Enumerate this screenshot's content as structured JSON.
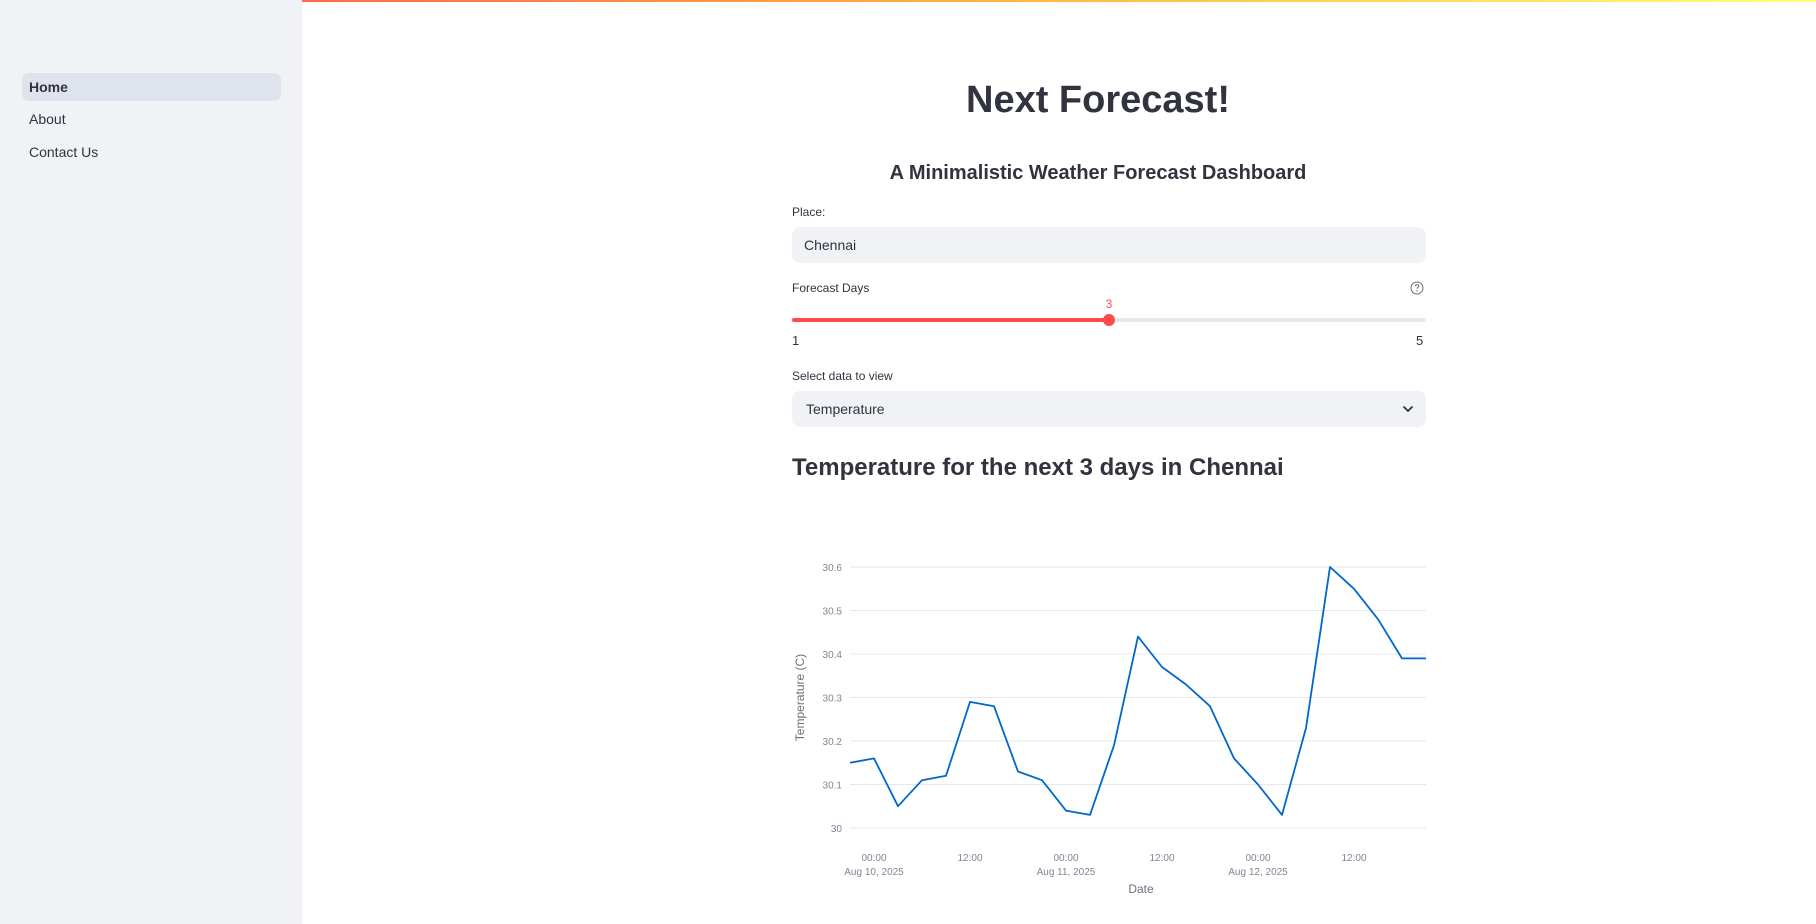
{
  "sidebar": {
    "items": [
      {
        "label": "Home",
        "active": true
      },
      {
        "label": "About",
        "active": false
      },
      {
        "label": "Contact Us",
        "active": false
      }
    ]
  },
  "main": {
    "title": "Next Forecast!",
    "subtitle": "A Minimalistic Weather Forecast Dashboard",
    "place": {
      "label": "Place:",
      "value": "Chennai",
      "placeholder": ""
    },
    "forecast_days": {
      "label": "Forecast Days",
      "min": 1,
      "max": 5,
      "value": 3,
      "min_label": "1",
      "max_label": "5",
      "value_label": "3"
    },
    "select": {
      "label": "Select data to view",
      "value": "Temperature"
    },
    "chart_heading": "Temperature for the next 3 days in Chennai"
  },
  "colors": {
    "accent": "#ff4b4b",
    "line": "#0068c9",
    "sidebar_bg": "#f0f2f6",
    "active_item_bg": "#dfe3eb",
    "text": "#31333f"
  },
  "chart_data": {
    "type": "line",
    "xlabel": "Date",
    "ylabel": "Temperature (C)",
    "ylim": [
      30,
      30.6
    ],
    "y_ticks": [
      "30",
      "30.1",
      "30.2",
      "30.3",
      "30.4",
      "30.5",
      "30.6"
    ],
    "x_ticks": [
      {
        "label": "00:00",
        "sublabel": "Aug 10, 2025"
      },
      {
        "label": "12:00",
        "sublabel": ""
      },
      {
        "label": "00:00",
        "sublabel": "Aug 11, 2025"
      },
      {
        "label": "12:00",
        "sublabel": ""
      },
      {
        "label": "00:00",
        "sublabel": "Aug 12, 2025"
      },
      {
        "label": "12:00",
        "sublabel": ""
      }
    ],
    "grid": true,
    "series": [
      {
        "x": [
          "2025-08-09 21:00",
          "2025-08-10 00:00",
          "2025-08-10 03:00",
          "2025-08-10 06:00",
          "2025-08-10 09:00",
          "2025-08-10 12:00",
          "2025-08-10 15:00",
          "2025-08-10 18:00",
          "2025-08-10 21:00",
          "2025-08-11 00:00",
          "2025-08-11 03:00",
          "2025-08-11 06:00",
          "2025-08-11 09:00",
          "2025-08-11 12:00",
          "2025-08-11 15:00",
          "2025-08-11 18:00",
          "2025-08-11 21:00",
          "2025-08-12 00:00",
          "2025-08-12 03:00",
          "2025-08-12 06:00",
          "2025-08-12 09:00",
          "2025-08-12 12:00",
          "2025-08-12 15:00",
          "2025-08-12 18:00",
          "2025-08-12 21:00"
        ],
        "values": [
          30.15,
          30.16,
          30.05,
          30.11,
          30.12,
          30.29,
          30.28,
          30.13,
          30.11,
          30.04,
          30.03,
          30.19,
          30.44,
          30.37,
          30.33,
          30.28,
          30.16,
          30.1,
          30.03,
          30.23,
          30.6,
          30.55,
          30.48,
          30.39,
          30.39
        ]
      }
    ]
  }
}
